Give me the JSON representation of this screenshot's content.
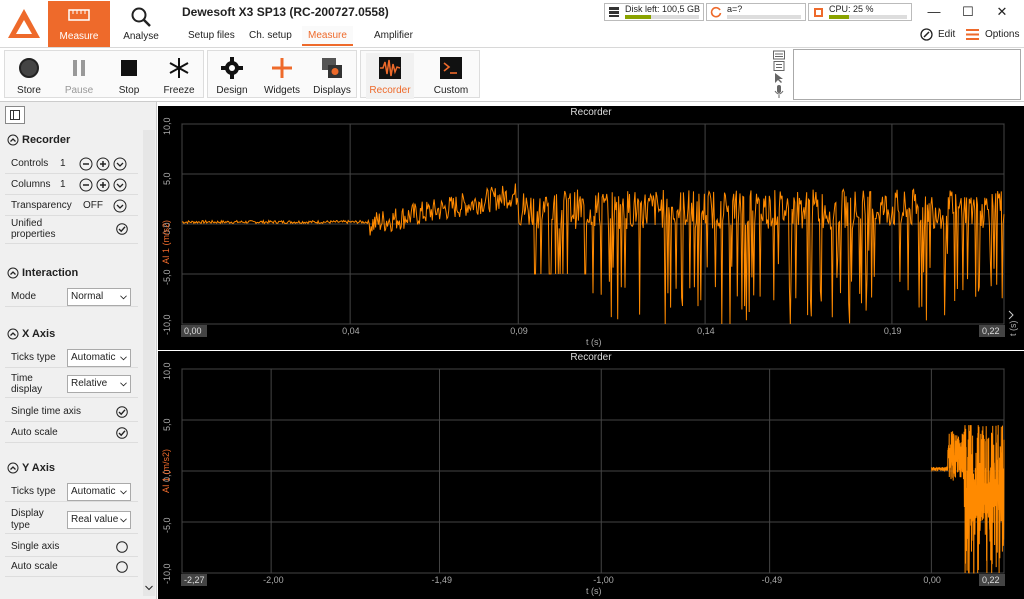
{
  "app": {
    "title": "Dewesoft X3 SP13 (RC-200727.0558)"
  },
  "top_modes": [
    {
      "label": "Measure",
      "active": true
    },
    {
      "label": "Analyse",
      "active": false
    }
  ],
  "subtabs": [
    {
      "label": "Setup files"
    },
    {
      "label": "Ch. setup"
    },
    {
      "label": "Measure"
    },
    {
      "label": "Amplifier"
    }
  ],
  "status": {
    "disk": {
      "text": "Disk left: 100,5 GB",
      "level": 0.35
    },
    "sync": {
      "text": "a=?"
    },
    "cpu": {
      "text": "CPU: 25 %",
      "level": 0.25
    }
  },
  "header_right": {
    "edit": "Edit",
    "options": "Options"
  },
  "toolbar": {
    "store": "Store",
    "pause": "Pause",
    "stop": "Stop",
    "freeze": "Freeze",
    "design": "Design",
    "widgets": "Widgets",
    "displays": "Displays",
    "recorder": "Recorder",
    "custom": "Custom"
  },
  "sidebar": {
    "recorder": {
      "title": "Recorder",
      "controls": {
        "label": "Controls",
        "value": "1"
      },
      "columns": {
        "label": "Columns",
        "value": "1"
      },
      "transparency": {
        "label": "Transparency",
        "value": "OFF"
      },
      "unified": {
        "label1": "Unified",
        "label2": "properties",
        "checked": true
      }
    },
    "interaction": {
      "title": "Interaction",
      "mode": {
        "label": "Mode",
        "value": "Normal"
      }
    },
    "xaxis": {
      "title": "X Axis",
      "ticks": {
        "label": "Ticks type",
        "value": "Automatic"
      },
      "time": {
        "label1": "Time",
        "label2": "display",
        "value": "Relative"
      },
      "single": {
        "label": "Single time axis",
        "checked": true
      },
      "auto": {
        "label": "Auto scale",
        "checked": true
      }
    },
    "yaxis": {
      "title": "Y Axis",
      "ticks": {
        "label": "Ticks type",
        "value": "Automatic"
      },
      "display": {
        "label1": "Display",
        "label2": "type",
        "value": "Real value"
      },
      "single": {
        "label": "Single axis",
        "checked": false
      },
      "auto": {
        "label": "Auto scale",
        "checked": false
      }
    }
  },
  "chart_data": [
    {
      "type": "line",
      "title": "Recorder",
      "xlabel": "t (s)",
      "ylabel": "AI 1 (m/s2)",
      "ylim": [
        -10,
        10
      ],
      "xlim": [
        0,
        0.22
      ],
      "yticks": [
        "10,0",
        "5,0",
        "0,0",
        "-5,0",
        "-10,0"
      ],
      "xticks": [
        "0,00",
        "0,04",
        "0,09",
        "0,14",
        "0,19",
        "0,22"
      ],
      "xticks_values": [
        0,
        0.045,
        0.09,
        0.14,
        0.19,
        0.22
      ],
      "series": [
        {
          "color": "#ff8a00",
          "x": [
            0,
            0.02,
            0.05,
            0.06,
            0.07,
            0.08,
            0.09,
            0.1,
            0.11,
            0.12,
            0.14,
            0.16,
            0.18,
            0.2,
            0.22
          ],
          "y": [
            0.2,
            0.2,
            0.3,
            0.8,
            1.2,
            2.2,
            3.5,
            -5,
            -8,
            -10,
            -9,
            -9,
            -9,
            -8,
            -2
          ]
        }
      ]
    },
    {
      "type": "line",
      "title": "Recorder",
      "xlabel": "t (s)",
      "ylabel": "AI 1 (m/s2)",
      "ylim": [
        -10,
        10
      ],
      "xlim": [
        -2.27,
        0.22
      ],
      "yticks": [
        "10,0",
        "5,0",
        "0,0",
        "-5,0",
        "-10,0"
      ],
      "xticks": [
        "-2,27",
        "-2,00",
        "-1,49",
        "-1,00",
        "-0,49",
        "0,00",
        "0,22"
      ],
      "xticks_values": [
        -2.27,
        -2.0,
        -1.49,
        -1.0,
        -0.49,
        0.0,
        0.22
      ],
      "series": [
        {
          "color": "#ff8a00",
          "x": [
            0,
            0.05,
            0.1,
            0.15,
            0.22
          ],
          "y": [
            0.2,
            0.5,
            4,
            -10,
            -8
          ]
        }
      ]
    }
  ],
  "colors": {
    "accent": "#ee6a2b",
    "signal": "#ff8a00"
  }
}
